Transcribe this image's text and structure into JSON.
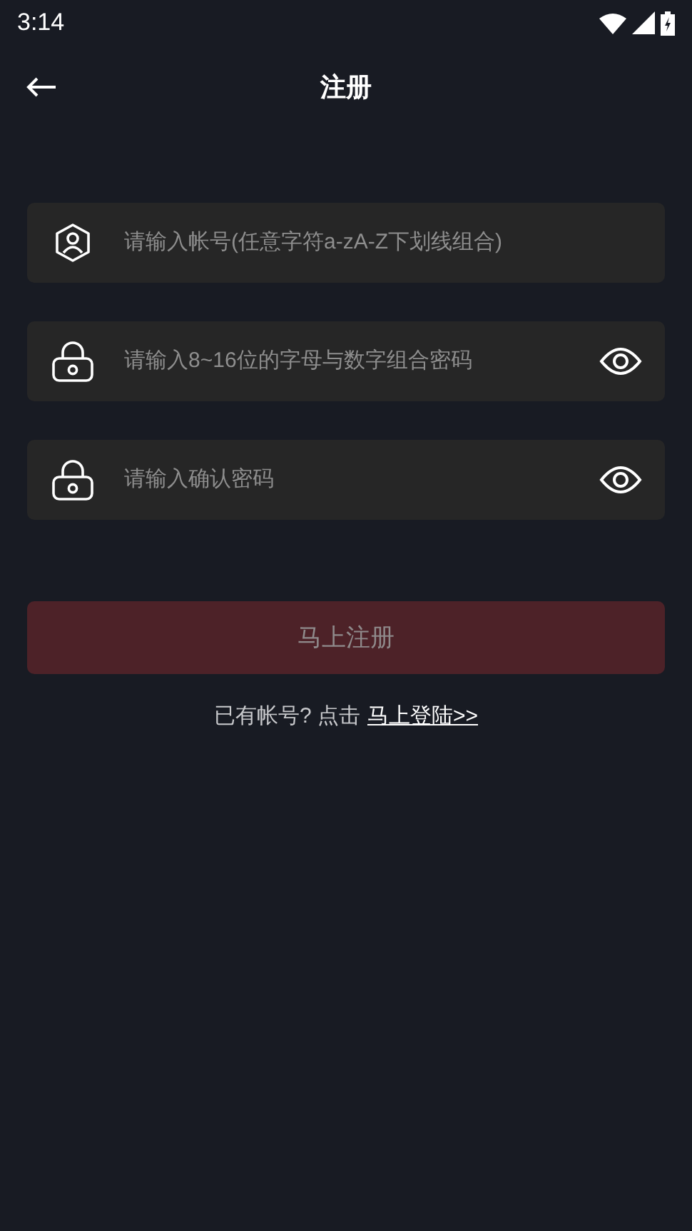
{
  "status_bar": {
    "time": "3:14"
  },
  "header": {
    "title": "注册"
  },
  "fields": [
    {
      "kind": "account",
      "placeholder": "请输入帐号(任意字符a-zA-Z下划线组合)",
      "reveal_toggle": false
    },
    {
      "kind": "password",
      "placeholder": "请输入8~16位的字母与数字组合密码",
      "reveal_toggle": true
    },
    {
      "kind": "password",
      "placeholder": "请输入确认密码",
      "reveal_toggle": true
    }
  ],
  "submit_button": {
    "label": "马上注册",
    "disabled": true
  },
  "login_prompt": {
    "text": "已有帐号? 点击",
    "link": "马上登陆>>"
  }
}
